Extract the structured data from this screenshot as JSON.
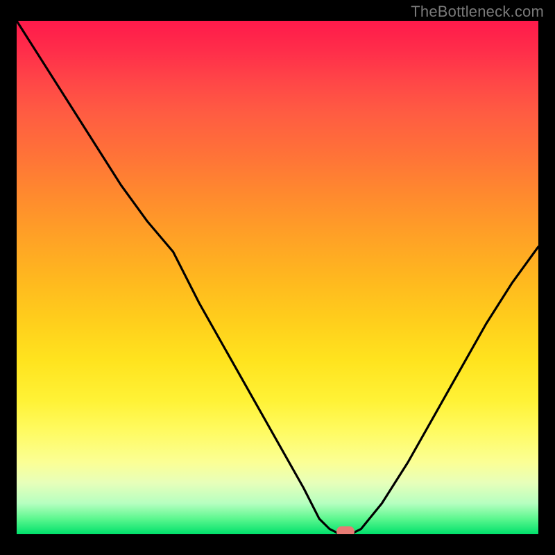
{
  "watermark": "TheBottleneck.com",
  "colors": {
    "background": "#000000",
    "curve": "#000000",
    "marker": "#e77b74",
    "gradient_top": "#ff1a4b",
    "gradient_bottom": "#00e06b"
  },
  "chart_data": {
    "type": "line",
    "title": "",
    "xlabel": "",
    "ylabel": "",
    "xlim": [
      0,
      100
    ],
    "ylim": [
      0,
      100
    ],
    "grid": false,
    "legend": false,
    "series": [
      {
        "name": "bottleneck-curve",
        "x": [
          0,
          5,
          10,
          15,
          20,
          25,
          30,
          35,
          40,
          45,
          50,
          55,
          58,
          60,
          62,
          64,
          66,
          70,
          75,
          80,
          85,
          90,
          95,
          100
        ],
        "y": [
          100,
          92,
          84,
          76,
          68,
          61,
          55,
          45,
          36,
          27,
          18,
          9,
          3,
          1,
          0,
          0,
          1,
          6,
          14,
          23,
          32,
          41,
          49,
          56
        ]
      }
    ],
    "annotations": [
      {
        "name": "optimal-marker",
        "x": 63,
        "y": 0.5
      }
    ],
    "background_gradient": {
      "direction": "vertical",
      "stops": [
        {
          "pos": 0,
          "color": "#ff1a4b"
        },
        {
          "pos": 50,
          "color": "#ffb71f"
        },
        {
          "pos": 80,
          "color": "#fffb62"
        },
        {
          "pos": 100,
          "color": "#00e06b"
        }
      ]
    }
  }
}
